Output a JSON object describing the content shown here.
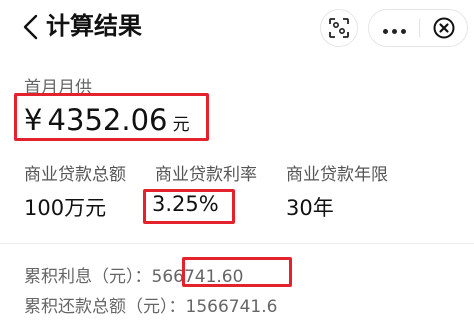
{
  "header": {
    "title": "计算结果",
    "colors": {
      "title": "#111111"
    },
    "icons": [
      "back-icon",
      "scan-icon",
      "more-icon",
      "close-icon"
    ]
  },
  "monthly": {
    "label": "首月月供",
    "currency": "¥",
    "value": "4352.06",
    "unit": "元"
  },
  "loan": {
    "amount_label": "商业贷款总额",
    "amount_value": "100万元",
    "rate_label": "商业贷款利率",
    "rate_value": "3.25%",
    "term_label": "商业贷款年限",
    "term_value": "30年"
  },
  "totals": {
    "interest_label": "累积利息（元）：",
    "interest_value": "566741.60",
    "repay_label": "累积还款总额（元）：",
    "repay_value": "1566741.6"
  },
  "highlight_color": "#e4222b"
}
